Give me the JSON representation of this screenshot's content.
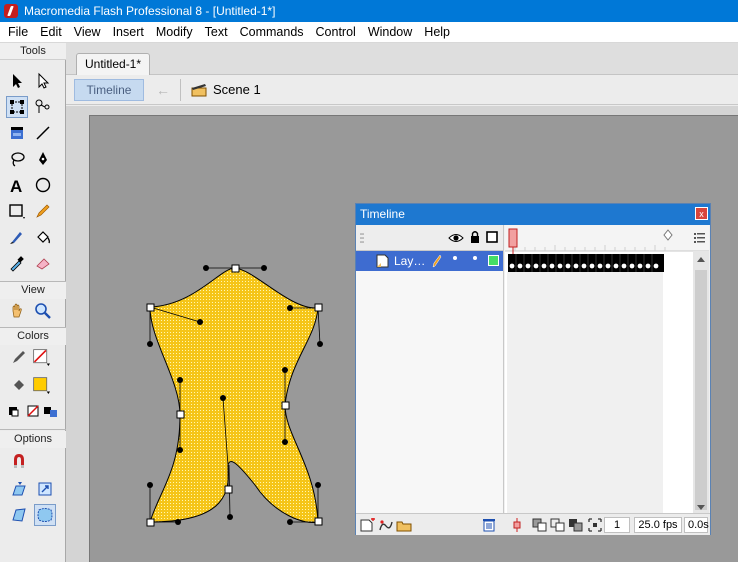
{
  "window": {
    "title": "Macromedia Flash Professional 8 - [Untitled-1*]"
  },
  "menu": [
    "File",
    "Edit",
    "View",
    "Insert",
    "Modify",
    "Text",
    "Commands",
    "Control",
    "Window",
    "Help"
  ],
  "tools_panel": {
    "tools_heading": "Tools",
    "view_heading": "View",
    "colors_heading": "Colors",
    "options_heading": "Options",
    "stroke_color": "#e01010",
    "fill_color": "#ffcc00"
  },
  "document": {
    "tab_label": "Untitled-1*",
    "timeline_button": "Timeline",
    "scene_label": "Scene 1"
  },
  "shape": {
    "fill_color": "#f5c518"
  },
  "timeline": {
    "title": "Timeline",
    "close_label": "x",
    "layer_name": "Lay…",
    "current_frame": "1",
    "frame_rate": "25.0 fps",
    "elapsed_time": "0.0s"
  }
}
